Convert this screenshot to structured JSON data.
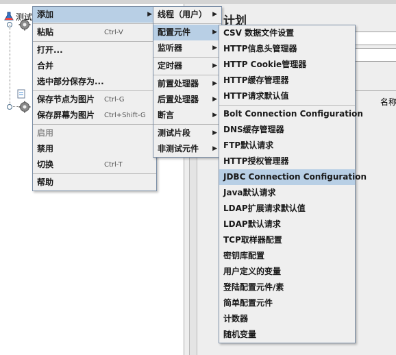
{
  "tree": {
    "root_label": "测试"
  },
  "right": {
    "title": "计划",
    "col_header": "名称"
  },
  "context_menu": {
    "items": [
      {
        "label": "添加",
        "submenu": true,
        "state": "selected"
      },
      {
        "sep": true
      },
      {
        "label": "粘贴",
        "shortcut": "Ctrl-V"
      },
      {
        "sep": true
      },
      {
        "label": "打开..."
      },
      {
        "label": "合并"
      },
      {
        "label": "选中部分保存为..."
      },
      {
        "sep": true
      },
      {
        "label": "保存节点为图片",
        "shortcut": "Ctrl-G"
      },
      {
        "label": "保存屏幕为图片",
        "shortcut": "Ctrl+Shift-G"
      },
      {
        "sep": true
      },
      {
        "label": "启用",
        "disabled": true
      },
      {
        "label": "禁用"
      },
      {
        "label": "切换",
        "shortcut": "Ctrl-T"
      },
      {
        "sep": true
      },
      {
        "label": "帮助"
      }
    ]
  },
  "add_submenu": {
    "items": [
      {
        "label": "线程（用户）",
        "submenu": true
      },
      {
        "sep": true
      },
      {
        "label": "配置元件",
        "submenu": true,
        "state": "selected"
      },
      {
        "label": "监听器",
        "submenu": true
      },
      {
        "sep": true
      },
      {
        "label": "定时器",
        "submenu": true
      },
      {
        "sep": true
      },
      {
        "label": "前置处理器",
        "submenu": true
      },
      {
        "label": "后置处理器",
        "submenu": true
      },
      {
        "label": "断言",
        "submenu": true
      },
      {
        "sep": true
      },
      {
        "label": "测试片段",
        "submenu": true
      },
      {
        "label": "非测试元件",
        "submenu": true
      }
    ]
  },
  "config_submenu": {
    "items": [
      {
        "label": "CSV 数据文件设置"
      },
      {
        "label": "HTTP信息头管理器"
      },
      {
        "label": "HTTP Cookie管理器"
      },
      {
        "label": "HTTP缓存管理器"
      },
      {
        "label": "HTTP请求默认值"
      },
      {
        "sep": true
      },
      {
        "label": "Bolt Connection Configuration"
      },
      {
        "label": "DNS缓存管理器"
      },
      {
        "label": "FTP默认请求"
      },
      {
        "label": "HTTP授权管理器"
      },
      {
        "label": "JDBC Connection Configuration",
        "state": "hover"
      },
      {
        "label": "Java默认请求"
      },
      {
        "label": "LDAP扩展请求默认值"
      },
      {
        "label": "LDAP默认请求"
      },
      {
        "label": "TCP取样器配置"
      },
      {
        "label": "密钥库配置"
      },
      {
        "label": "用户定义的变量"
      },
      {
        "label": "登陆配置元件/素"
      },
      {
        "label": "简单配置元件"
      },
      {
        "label": "计数器"
      },
      {
        "label": "随机变量"
      }
    ]
  },
  "icons": {
    "submenu_arrow": "chevron-right-icon",
    "gear": "gear-icon",
    "flask": "flask-icon"
  },
  "colors": {
    "selection": "#b8cfe5",
    "menu_bg": "#efefef",
    "menu_border": "#7b8ea6"
  }
}
